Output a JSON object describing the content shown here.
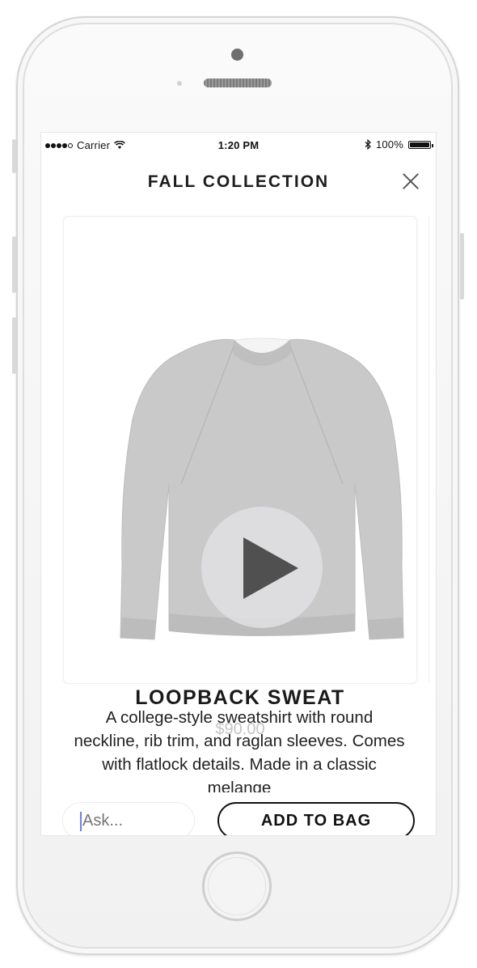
{
  "status_bar": {
    "carrier": "Carrier",
    "time": "1:20 PM",
    "battery": "100%",
    "wifi_icon": "wifi-icon",
    "bluetooth_icon": "bluetooth-icon"
  },
  "nav": {
    "title": "FALL COLLECTION",
    "close_icon": "close-icon"
  },
  "product": {
    "name": "LOOPBACK SWEAT",
    "price": "$90.00",
    "image_icon": "sweatshirt-image",
    "play_icon": "play-icon"
  },
  "description": "A college-style sweatshirt with round neckline, rib trim, and raglan sleeves. Comes with flatlock details. Made in a classic melange",
  "footer": {
    "ask_placeholder": "Ask...",
    "add_to_bag_label": "ADD TO BAG"
  },
  "colors": {
    "accent_caret": "#6b7cff",
    "price_gray": "#c4c4c4",
    "sweater_gray": "#c9c9c9"
  }
}
